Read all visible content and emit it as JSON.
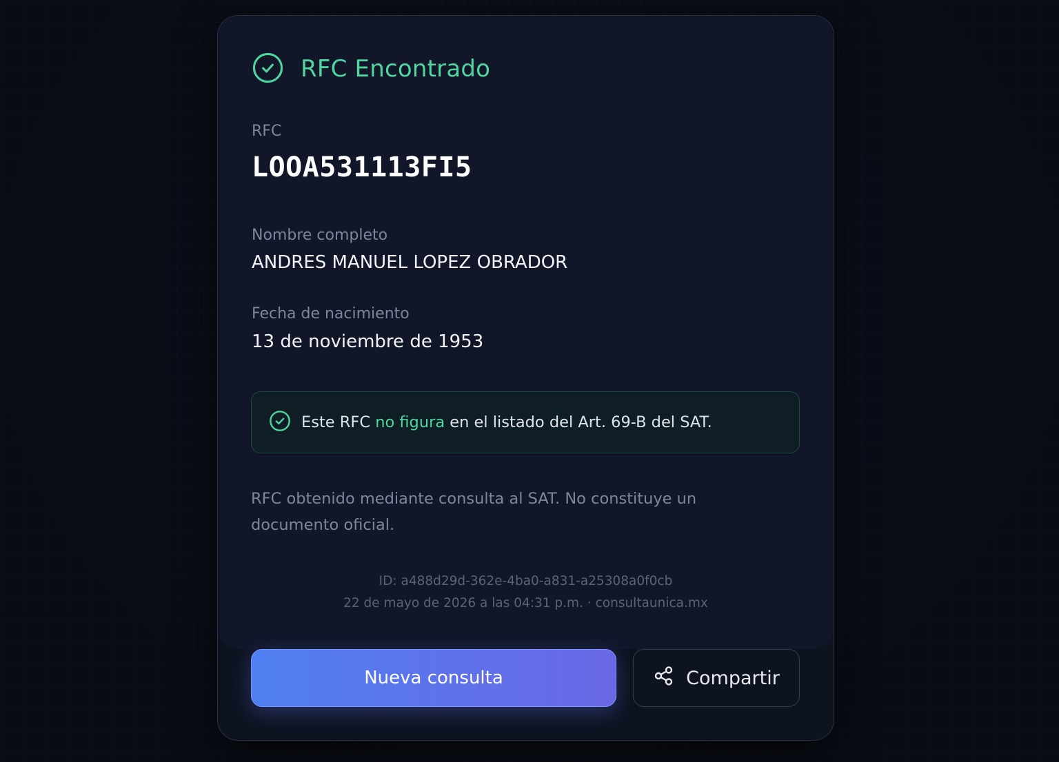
{
  "header": {
    "title": "RFC Encontrado",
    "icon": "check-circle-icon"
  },
  "rfc": {
    "label": "RFC",
    "value": "LOOA531113FI5"
  },
  "nombre": {
    "label": "Nombre completo",
    "value": "ANDRES MANUEL LOPEZ OBRADOR"
  },
  "fecha": {
    "label": "Fecha de nacimiento",
    "value": "13 de noviembre de 1953"
  },
  "notice": {
    "icon": "check-circle-icon",
    "before": "Este RFC ",
    "highlight": "no figura",
    "after": " en el listado del Art. 69-B del SAT."
  },
  "disclaimer": "RFC obtenido mediante consulta al SAT. No constituye un documento oficial.",
  "meta": {
    "id": "ID: a488d29d-362e-4ba0-a831-a25308a0f0cb",
    "timestamp": "22 de mayo de 2026 a las 04:31 p.m. · consultaunica.mx"
  },
  "actions": {
    "primary_label": "Nueva consulta",
    "secondary_label": "Compartir",
    "secondary_icon": "share-icon"
  },
  "colors": {
    "success": "#4ed5a0",
    "primary_start": "#4f7ff0",
    "primary_end": "#6b68e6"
  }
}
